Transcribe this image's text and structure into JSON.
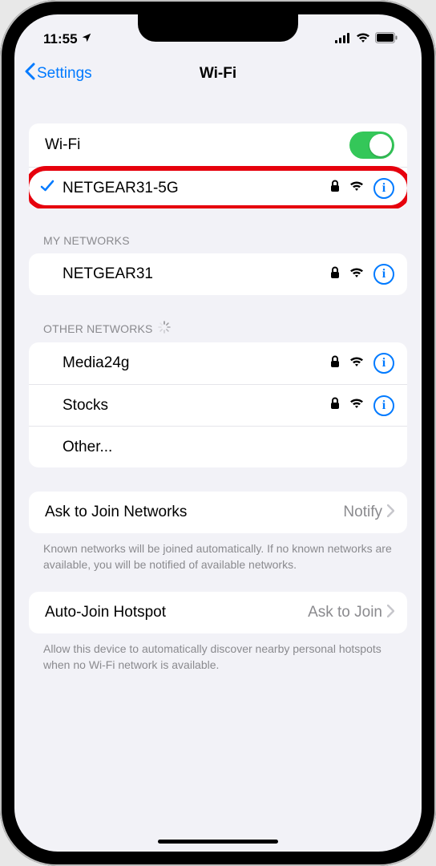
{
  "status": {
    "time": "11:55",
    "location_icon": "location-arrow"
  },
  "nav": {
    "back_label": "Settings",
    "title": "Wi-Fi"
  },
  "wifi": {
    "toggle_label": "Wi-Fi",
    "enabled": true,
    "connected": {
      "name": "NETGEAR31-5G",
      "secured": true,
      "highlighted": true
    }
  },
  "sections": {
    "my_networks": {
      "header": "MY NETWORKS",
      "items": [
        {
          "name": "NETGEAR31",
          "secured": true
        }
      ]
    },
    "other_networks": {
      "header": "OTHER NETWORKS",
      "loading": true,
      "items": [
        {
          "name": "Media24g",
          "secured": true
        },
        {
          "name": "Stocks",
          "secured": true
        }
      ],
      "other_label": "Other..."
    }
  },
  "ask_join": {
    "label": "Ask to Join Networks",
    "value": "Notify",
    "footnote": "Known networks will be joined automatically. If no known networks are available, you will be notified of available networks."
  },
  "auto_hotspot": {
    "label": "Auto-Join Hotspot",
    "value": "Ask to Join",
    "footnote": "Allow this device to automatically discover nearby personal hotspots when no Wi-Fi network is available."
  }
}
